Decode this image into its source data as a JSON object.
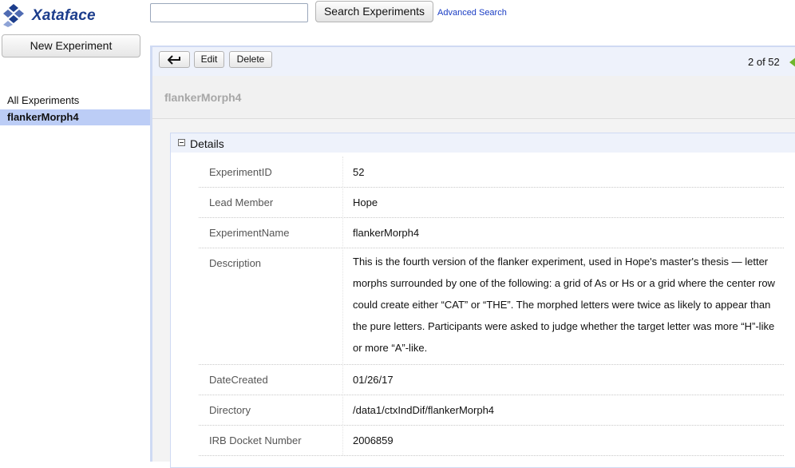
{
  "app": {
    "name": "Xataface"
  },
  "search": {
    "placeholder": "",
    "button_label": "Search Experiments",
    "advanced_label": "Advanced Search"
  },
  "sidebar": {
    "new_button": "New Experiment",
    "items": [
      {
        "label": "All Experiments",
        "selected": false
      },
      {
        "label": "flankerMorph4",
        "selected": true
      }
    ]
  },
  "toolbar": {
    "back_icon": "back-arrow-icon",
    "edit_label": "Edit",
    "delete_label": "Delete",
    "pager": "2 of 52",
    "next_icon": "next-arrow-icon"
  },
  "record": {
    "title": "flankerMorph4",
    "section_label": "Details",
    "fields": [
      {
        "label": "ExperimentID",
        "value": "52"
      },
      {
        "label": "Lead Member",
        "value": "Hope"
      },
      {
        "label": "ExperimentName",
        "value": "flankerMorph4"
      },
      {
        "label": "Description",
        "value": "This is the fourth version of the flanker experiment, used in Hope's master's thesis — letter morphs surrounded by one of the following: a grid of As or Hs or a grid where the center row could create either “CAT” or “THE”. The morphed letters were twice as likely to appear than the pure letters. Participants were asked to judge whether the target letter was more “H”-like or more “A”-like."
      },
      {
        "label": "DateCreated",
        "value": "01/26/17"
      },
      {
        "label": "Directory",
        "value": "/data1/ctxIndDif/flankerMorph4"
      },
      {
        "label": "IRB Docket Number",
        "value": "2006859"
      }
    ]
  },
  "colors": {
    "brand": "#1c3d8c",
    "selection": "#bccdf6",
    "panel_border": "#cfdaf3",
    "next_arrow": "#6fb62c"
  }
}
